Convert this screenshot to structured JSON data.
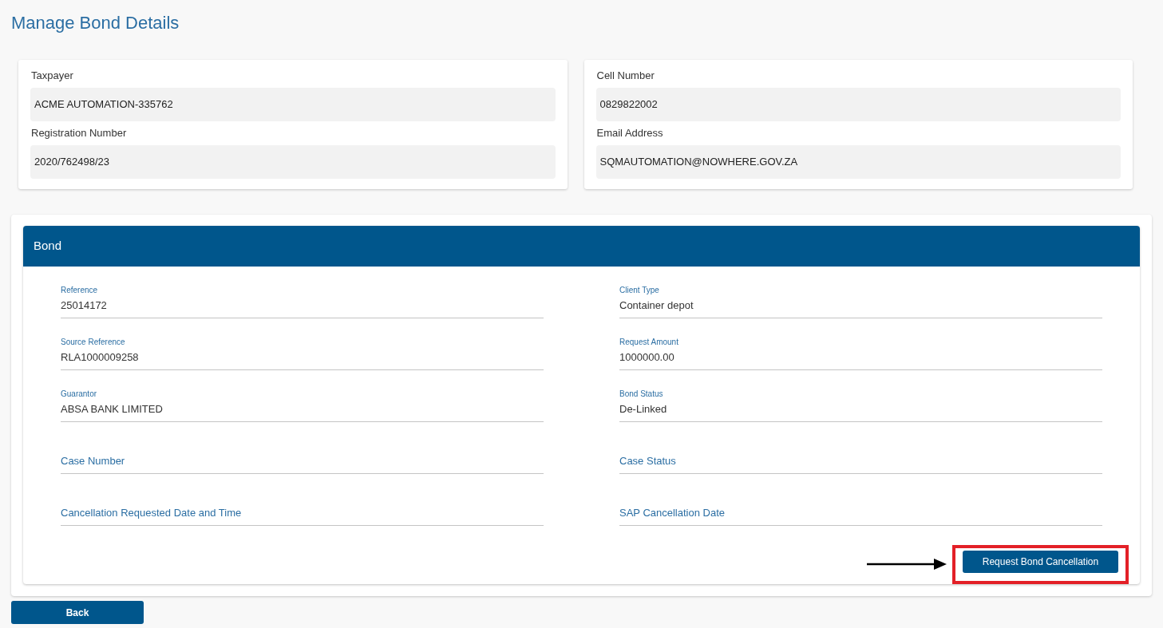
{
  "page_title": "Manage Bond Details",
  "taxpayer_cards": [
    {
      "fields": [
        {
          "label": "Taxpayer",
          "value": "ACME AUTOMATION-335762"
        },
        {
          "label": "Registration Number",
          "value": "2020/762498/23"
        }
      ]
    },
    {
      "fields": [
        {
          "label": "Cell Number",
          "value": "0829822002"
        },
        {
          "label": "Email Address",
          "value": "SQMAUTOMATION@NOWHERE.GOV.ZA"
        }
      ]
    }
  ],
  "bond": {
    "title": "Bond",
    "fields": [
      {
        "label": "Reference",
        "value": "25014172"
      },
      {
        "label": "Client Type",
        "value": "Container depot"
      },
      {
        "label": "Source Reference",
        "value": "RLA1000009258"
      },
      {
        "label": "Request Amount",
        "value": "1000000.00"
      },
      {
        "label": "Guarantor",
        "value": "ABSA BANK LIMITED"
      },
      {
        "label": "Bond Status",
        "value": "De-Linked"
      },
      {
        "label": "Case Number"
      },
      {
        "label": "Case Status"
      },
      {
        "label": "Cancellation Requested Date and Time"
      },
      {
        "label": "SAP Cancellation Date"
      }
    ],
    "action_button": "Request Bond Cancellation"
  },
  "back_button": "Back"
}
